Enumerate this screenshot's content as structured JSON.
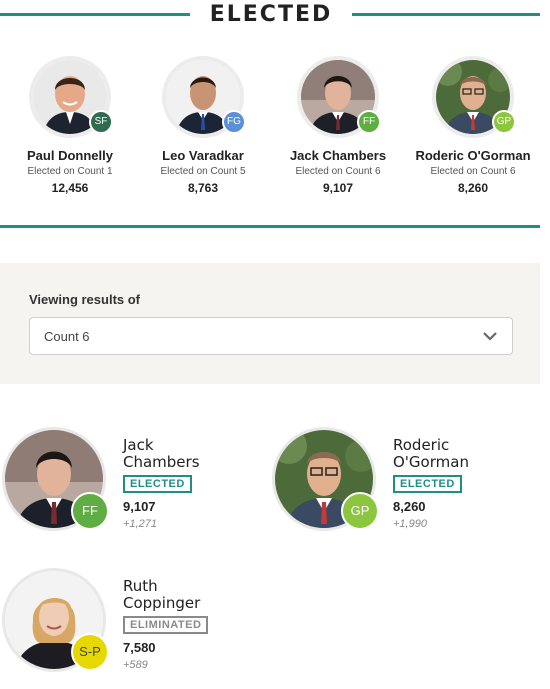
{
  "header": {
    "title": "ELECTED"
  },
  "elected": [
    {
      "name": "Paul Donnelly",
      "count": "Elected on Count 1",
      "votes": "12,456",
      "party": "SF",
      "party_color": "#2f6b4f"
    },
    {
      "name": "Leo Varadkar",
      "count": "Elected on Count 5",
      "votes": "8,763",
      "party": "FG",
      "party_color": "#5b8fd8"
    },
    {
      "name": "Jack Chambers",
      "count": "Elected on Count 6",
      "votes": "9,107",
      "party": "FF",
      "party_color": "#5fae43"
    },
    {
      "name": "Roderic O'Gorman",
      "count": "Elected on Count 6",
      "votes": "8,260",
      "party": "GP",
      "party_color": "#8cc63f"
    }
  ],
  "viewing": {
    "label": "Viewing results of",
    "selected": "Count 6"
  },
  "candidates": [
    {
      "name_line1": "Jack",
      "name_line2": "Chambers",
      "status": "ELECTED",
      "votes": "9,107",
      "delta": "+1,271",
      "party": "FF",
      "party_color": "#5fae43"
    },
    {
      "name_line1": "Roderic",
      "name_line2": "O'Gorman",
      "status": "ELECTED",
      "votes": "8,260",
      "delta": "+1,990",
      "party": "GP",
      "party_color": "#8cc63f"
    },
    {
      "name_line1": "Ruth",
      "name_line2": "Coppinger",
      "status": "ELIMINATED",
      "votes": "7,580",
      "delta": "+589",
      "party": "S-P",
      "party_color": "#e6d800"
    }
  ],
  "colors": {
    "accent": "#1f8f86",
    "panel_bg": "#f6f4f0"
  }
}
